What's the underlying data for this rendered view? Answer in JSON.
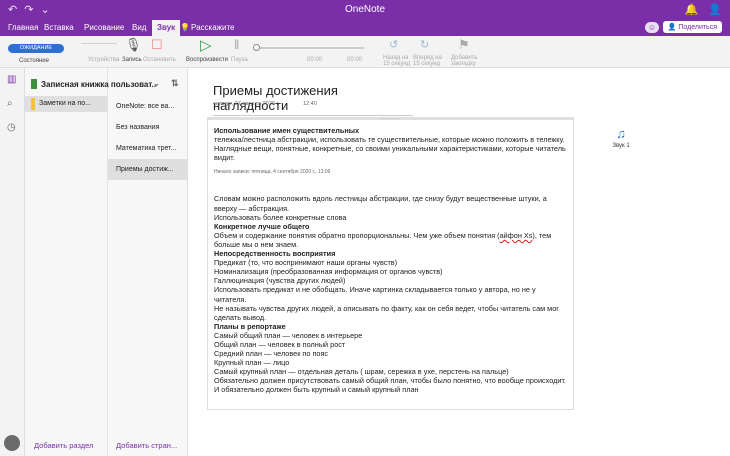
{
  "window": {
    "title": "OneNote"
  },
  "tabs": [
    "Главная",
    "Вставка",
    "Рисование",
    "Вид",
    "Звук",
    "Расскажите"
  ],
  "active_tab": "Звук",
  "share_label": "Поделиться",
  "ribbon": {
    "status_pill": "ОЖИДАНИЕ",
    "status_label": "Состояние",
    "devices_label": "Устройства",
    "record_label": "Запись",
    "stop_label": "Остановить",
    "play_label": "Воспроизвести",
    "pause_label": "Пауза",
    "time_start": "00:00",
    "time_end": "00:00",
    "back_label": "Назад на 15 секунд",
    "forward_label": "Вперед на 15 секунд",
    "bookmark_label": "Добавить закладку",
    "skip_number": "15"
  },
  "notebook": {
    "name": "Записная книжка пользоват..."
  },
  "sections": [
    {
      "name": "Заметки на по...",
      "color": "#f2c32c"
    }
  ],
  "pages": [
    "OneNote: все ва...",
    "Без названия",
    "Математика трет...",
    "Приемы достиж..."
  ],
  "add_section": "Добавить раздел",
  "add_page": "Добавить стран...",
  "page": {
    "title": "Приемы достижения наглядности",
    "date": "четверг, 27 августа 2020 г.",
    "time": "12:40"
  },
  "note": {
    "heading1": "Использование имен существительных",
    "p1": "тележка/лестница абстракции, использовать те существительные, которые можно положить в тележку. Наглядные вещи, понятные, конкретные, со своими уникальными характеристиками, которые читатель видит.",
    "rec": "Начало записи: пятница, 4 сентября 2020 г., 13:09",
    "p2": "Словам можно расположить вдоль лестницы абстракции, где снизу будут вещественные штуки, а вверху — абстракция.",
    "p3": "Использовать более конкретные слова",
    "h2": "Конкретное лучше общего",
    "p4a": "Объем и содержание понятия обратно пропорциональны. Чем уже объем понятия (",
    "p4b": "айфон Xs",
    "p4c": "), тем больше мы о нем знаем.",
    "h3": "Непосредственность восприятия",
    "p5": "Предикат (то, что воспринимают наши органы чувств)",
    "p6": "Номинализация (преобразованная информация от органов чувств)",
    "p7": "Галлюцинация (чувства других людей)",
    "p8": "Использовать предикат и не обобщать. Иначе картинка складывается только у автора, но не у читателя.",
    "p9": "Не называть чувства других людей, а описывать по факту, как он себя ведет, чтобы читатель сам мог сделать вывод.",
    "h4": "Планы в репортаже",
    "p10": "Самый общий план — человек в интерьере",
    "p11": "Общий план — человек в полный рост",
    "p12": "Средний план — человек по пояс",
    "p13": "Крупный план — лицо",
    "p14": "Самый крупный план — отдельная деталь ( шрам, сережка в ухе, перстень на пальце)",
    "p15": "Обязательно должен присутствовать самый общий план, чтобы было понятно, что вообще происходит. И обязательно должен быть крупный и самый крупный план"
  },
  "attachment": {
    "label": "Звук 1"
  }
}
